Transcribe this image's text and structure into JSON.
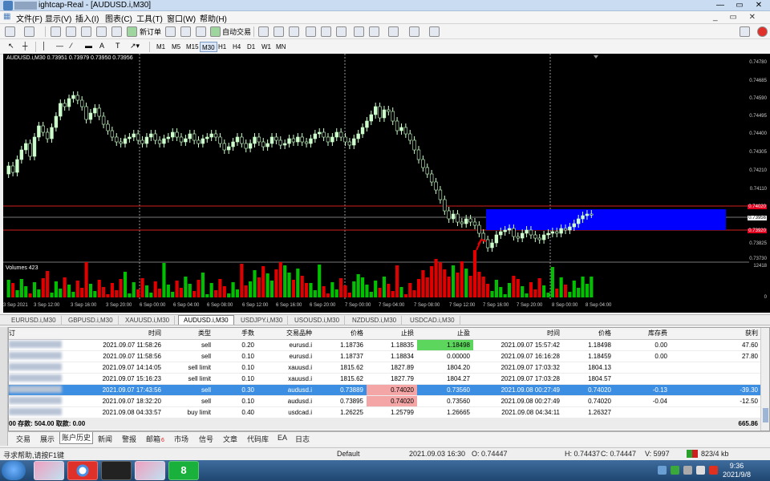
{
  "window": {
    "title": "ightcap-Real - [AUDUSD.i,M30]",
    "min": "—",
    "max": "▭",
    "close": "✕"
  },
  "menu": [
    "文件(F)",
    "显示(V)",
    "插入(I)",
    "图表(C)",
    "工具(T)",
    "窗口(W)",
    "帮助(H)"
  ],
  "menu_right": "_ ▭ ✕",
  "toolbar1": {
    "new_order": "新订单",
    "auto_trade": "自动交易"
  },
  "toolbar2": {
    "timeframes": [
      "M1",
      "M5",
      "M15",
      "M30",
      "H1",
      "H4",
      "D1",
      "W1",
      "MN"
    ],
    "selected": "M30"
  },
  "chart": {
    "symbol_line": "AUDUSD.i,M30  0.73951 0.73979 0.73950 0.73956",
    "volumes_label": "Volumes 423",
    "vol_top": "12418",
    "vol_bottom": "0",
    "price_labels": [
      "0.74780",
      "0.74685",
      "0.74590",
      "0.74495",
      "0.74400",
      "0.74305",
      "0.74210",
      "0.74110",
      "0.74020",
      "0.73956",
      "0.73920",
      "0.73825",
      "0.73730"
    ],
    "current_price": "0.73956",
    "sl_price": "0.74020",
    "tp_price": "0.73920",
    "time_labels": [
      "3 Sep 2021",
      "3 Sep 12:00",
      "3 Sep 16:00",
      "3 Sep 20:00",
      "6 Sep 00:00",
      "6 Sep 04:00",
      "6 Sep 08:00",
      "6 Sep 12:00",
      "6 Sep 16:00",
      "6 Sep 20:00",
      "7 Sep 00:00",
      "7 Sep 04:00",
      "7 Sep 08:00",
      "7 Sep 12:00",
      "7 Sep 16:00",
      "7 Sep 20:00",
      "8 Sep 00:00",
      "8 Sep 04:00"
    ],
    "colors": {
      "bg": "#000000",
      "candle": "#ccffcc",
      "volume_up": "#00c000",
      "volume_down": "#e00000",
      "zone": "#0000ff",
      "level": "#d02020"
    }
  },
  "symbol_tabs": [
    "EURUSD.i,M30",
    "GBPUSD.i,M30",
    "XAUUSD.i,M30",
    "AUDUSD.i,M30",
    "USDJPY.i,M30",
    "USOUSD.i,M30",
    "NZDUSD.i,M30",
    "USDCAD.i,M30"
  ],
  "active_symbol_tab": "AUDUSD.i,M30",
  "history": {
    "headers": [
      "订",
      "时间",
      "类型",
      "手数",
      "交易品种",
      "价格",
      "止损",
      "止盈",
      "时间",
      "价格",
      "库存费",
      "获利"
    ],
    "rows": [
      [
        "",
        "2021.09.07 11:58:26",
        "sell",
        "0.20",
        "eurusd.i",
        "1.18736",
        "1.18835",
        "1.18498",
        "2021.09.07 15:57:42",
        "1.18498",
        "0.00",
        "47.60"
      ],
      [
        "",
        "2021.09.07 11:58:56",
        "sell",
        "0.10",
        "eurusd.i",
        "1.18737",
        "1.18834",
        "0.00000",
        "2021.09.07 16:16:28",
        "1.18459",
        "0.00",
        "27.80"
      ],
      [
        "",
        "2021.09.07 14:14:05",
        "sell limit",
        "0.10",
        "xauusd.i",
        "1815.62",
        "1827.89",
        "1804.20",
        "2021.09.07 17:03:32",
        "1804.13",
        "",
        ""
      ],
      [
        "",
        "2021.09.07 15:16:23",
        "sell limit",
        "0.10",
        "xauusd.i",
        "1815.62",
        "1827.79",
        "1804.27",
        "2021.09.07 17:03:28",
        "1804.57",
        "",
        ""
      ],
      [
        "",
        "2021.09.07 17:43:56",
        "sell",
        "0.30",
        "audusd.i",
        "0.73889",
        "0.74020",
        "0.73560",
        "2021.09.08 00:27:49",
        "0.74020",
        "-0.13",
        "-39.30"
      ],
      [
        "",
        "2021.09.07 18:32:20",
        "sell",
        "0.10",
        "audusd.i",
        "0.73895",
        "0.74020",
        "0.73560",
        "2021.09.08 00:27:49",
        "0.74020",
        "-0.04",
        "-12.50"
      ],
      [
        "",
        "2021.09.08 04:33:57",
        "buy limit",
        "0.40",
        "usdcad.i",
        "1.26225",
        "1.25799",
        "1.26665",
        "2021.09.08 04:34:11",
        "1.26327",
        "",
        ""
      ]
    ],
    "total_label": "00  存款: 504.00  取款: 0.00",
    "total_value": "665.86"
  },
  "terminal_tabs": [
    "交易",
    "展示",
    "账户历史",
    "新闻",
    "警报",
    "邮箱",
    "市场",
    "信号",
    "文章",
    "代码库",
    "EA",
    "日志"
  ],
  "active_terminal_tab": "账户历史",
  "mail_badge": "6",
  "status": {
    "help": "寻求帮助,请按F1键",
    "profile": "Default",
    "datetime": "2021.09.03 16:30",
    "open": "O: 0.74447",
    "high": "H: 0.74437",
    "close": "C: 0.74447",
    "volume": "V: 5997",
    "traffic": "823/4 kb"
  },
  "taskbar": {
    "time": "9:36",
    "date": "2021/9/8",
    "apps": [
      "",
      "",
      "",
      "",
      "8"
    ]
  }
}
